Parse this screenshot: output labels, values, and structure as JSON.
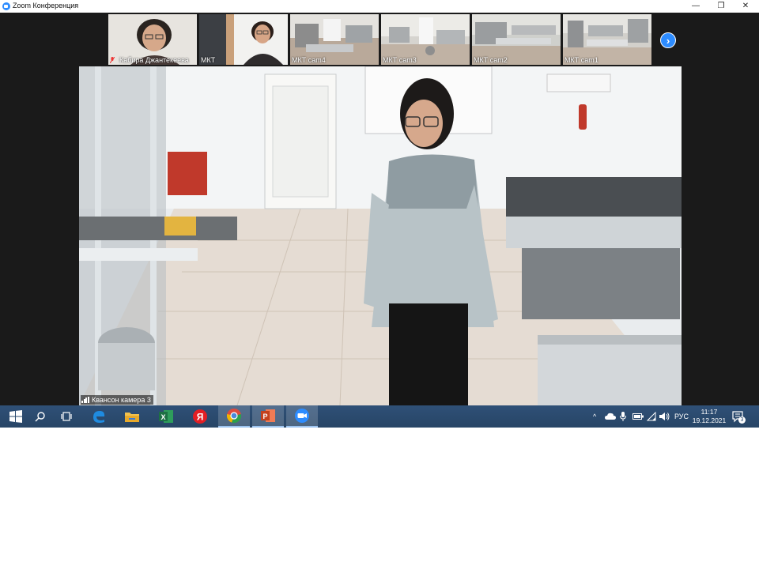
{
  "window": {
    "title": "Zoom Конференция",
    "minimize_glyph": "—",
    "maximize_glyph": "❐",
    "close_glyph": "✕"
  },
  "participants": [
    {
      "name": "Кабира Джантекеева",
      "muted": true
    },
    {
      "name": "МКТ",
      "muted": false
    },
    {
      "name": "МКТ cam4",
      "muted": false
    },
    {
      "name": "МКТ cam3",
      "muted": false
    },
    {
      "name": "МКТ cam2",
      "muted": false
    },
    {
      "name": "МКТ cam1",
      "muted": false
    }
  ],
  "strip_next_glyph": "›",
  "active_speaker": {
    "name": "Квансон камера 3"
  },
  "taskbar": {
    "apps": [
      {
        "name": "start-icon"
      },
      {
        "name": "search-icon"
      },
      {
        "name": "task-view-icon"
      },
      {
        "name": "edge-icon"
      },
      {
        "name": "file-explorer-icon"
      },
      {
        "name": "excel-icon"
      },
      {
        "name": "yandex-browser-icon"
      },
      {
        "name": "chrome-icon"
      },
      {
        "name": "powerpoint-icon"
      },
      {
        "name": "zoom-icon"
      }
    ],
    "tray": {
      "chevron": "^",
      "language": "РУС",
      "time": "11:17",
      "date": "19.12.2021",
      "notification_count": "3"
    }
  },
  "colors": {
    "zoom_bg": "#1a1a1a",
    "zoom_blue": "#2d8cff",
    "taskbar": "#2b4a6e"
  }
}
